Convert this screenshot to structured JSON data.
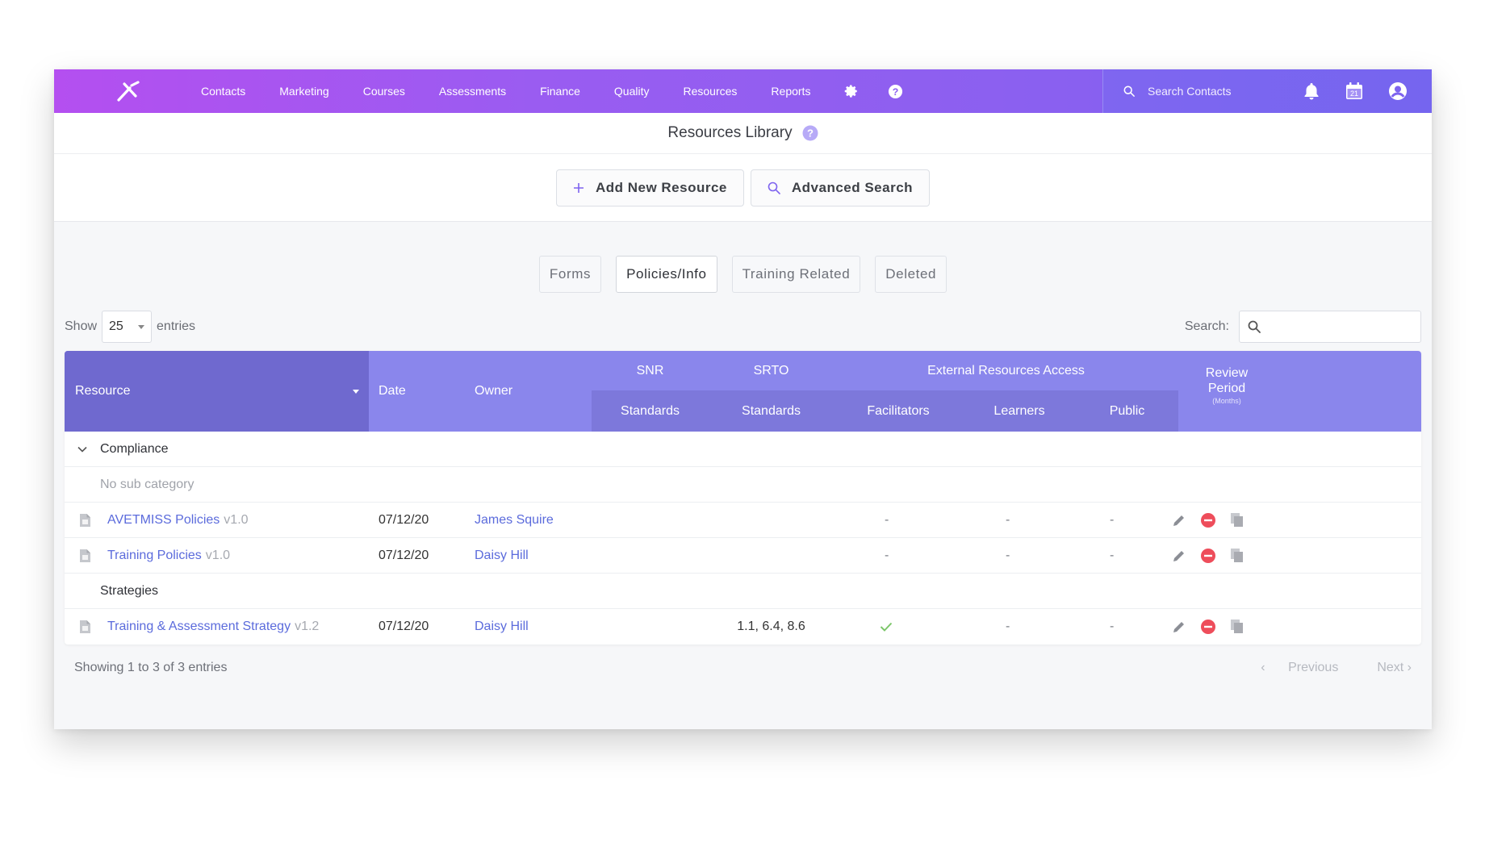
{
  "nav": {
    "items": [
      "Contacts",
      "Marketing",
      "Courses",
      "Assessments",
      "Finance",
      "Quality",
      "Resources",
      "Reports"
    ],
    "search_placeholder": "Search Contacts",
    "calendar_day": "21"
  },
  "page": {
    "title": "Resources Library"
  },
  "actions": {
    "add_label": "Add New Resource",
    "search_label": "Advanced Search"
  },
  "tabs": [
    {
      "label": "Forms",
      "active": false
    },
    {
      "label": "Policies/Info",
      "active": true
    },
    {
      "label": "Training Related",
      "active": false
    },
    {
      "label": "Deleted",
      "active": false
    }
  ],
  "controls": {
    "show_label": "Show",
    "entries_value": "25",
    "entries_label": "entries",
    "search_label": "Search:"
  },
  "table": {
    "headers": {
      "resource": "Resource",
      "date": "Date",
      "owner": "Owner",
      "snr": "SNR",
      "srto": "SRTO",
      "external": "External Resources Access",
      "review_line1": "Review",
      "review_line2": "Period",
      "review_unit": "(Months)",
      "snr_sub": "Standards",
      "srto_sub": "Standards",
      "facilitators": "Facilitators",
      "learners": "Learners",
      "public": "Public"
    },
    "group": "Compliance",
    "no_sub": "No sub category",
    "rows1": [
      {
        "name": "AVETMISS Policies",
        "version": "v1.0",
        "date": "07/12/20",
        "owner": "James Squire",
        "facilitators": "-",
        "learners": "-",
        "public": "-"
      },
      {
        "name": "Training Policies",
        "version": "v1.0",
        "date": "07/12/20",
        "owner": "Daisy Hill",
        "facilitators": "-",
        "learners": "-",
        "public": "-"
      }
    ],
    "subcategory": "Strategies",
    "rows2": [
      {
        "name": "Training & Assessment Strategy",
        "version": "v1.2",
        "date": "07/12/20",
        "owner": "Daisy Hill",
        "srto": "1.1, 6.4, 8.6",
        "learners": "-",
        "public": "-"
      }
    ]
  },
  "footer": {
    "summary": "Showing 1 to 3 of 3 entries",
    "previous": "Previous",
    "next": "Next"
  }
}
